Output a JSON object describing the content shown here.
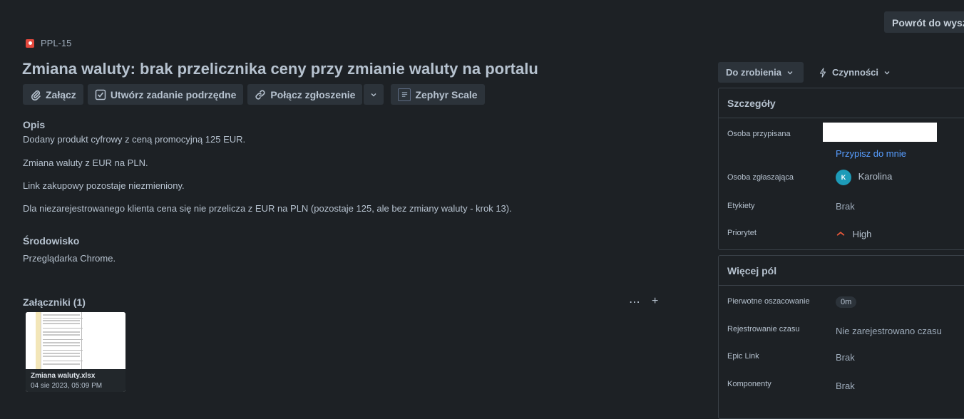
{
  "header": {
    "back_label": "Powrót do wyszukiwania"
  },
  "issue": {
    "key": "PPL-15",
    "type_icon": "bug-icon",
    "title": "Zmiana waluty: brak przelicznika ceny przy zmianie waluty na portalu"
  },
  "toolbar": {
    "attach_label": "Załącz",
    "subtask_label": "Utwórz zadanie podrzędne",
    "link_label": "Połącz zgłoszenie",
    "zephyr_label": "Zephyr Scale"
  },
  "description": {
    "heading": "Opis",
    "lines": [
      "Dodany produkt cyfrowy z ceną promocyjną 125 EUR.",
      "Zmiana waluty z EUR na PLN.",
      "Link zakupowy pozostaje niezmieniony.",
      "Dla niezarejestrowanego klienta cena się nie przelicza z EUR na PLN (pozostaje 125, ale bez zmiany waluty - krok 13)."
    ]
  },
  "environment": {
    "heading": "Środowisko",
    "value": "Przeglądarka Chrome."
  },
  "attachments": {
    "heading": "Załączniki (1)",
    "more_icon": "more-icon",
    "add_icon": "plus-icon",
    "items": [
      {
        "name": "Zmiana waluty.xlsx",
        "date": "04 sie 2023, 05:09 PM"
      }
    ]
  },
  "status": {
    "label": "Do zrobienia",
    "actions_label": "Czynności"
  },
  "details": {
    "heading": "Szczegóły",
    "assignee_label": "Osoba przypisana",
    "assign_me": "Przypisz do mnie",
    "reporter_label": "Osoba zgłaszająca",
    "reporter_initial": "K",
    "reporter_name": "Karolina",
    "labels_label": "Etykiety",
    "labels_value": "Brak",
    "priority_label": "Priorytet",
    "priority_value": "High"
  },
  "more_fields": {
    "heading": "Więcej pól",
    "estimate_label": "Pierwotne oszacowanie",
    "estimate_value": "0m",
    "time_label": "Rejestrowanie czasu",
    "time_value": "Nie zarejestrowano czasu",
    "epic_label": "Epic Link",
    "epic_value": "Brak",
    "components_label": "Komponenty",
    "components_value": "Brak"
  },
  "colors": {
    "background": "#1d2125",
    "accent_link": "#579dff",
    "bug": "#e2483d",
    "priority_high": "#f15b3b"
  }
}
